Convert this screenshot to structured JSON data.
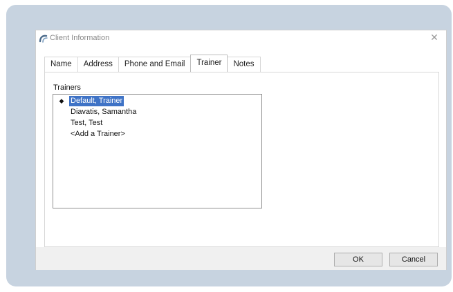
{
  "window": {
    "title": "Client Information",
    "close_glyph": "✕"
  },
  "tabs": [
    {
      "label": "Name"
    },
    {
      "label": "Address"
    },
    {
      "label": "Phone and Email"
    },
    {
      "label": "Trainer",
      "active": true
    },
    {
      "label": "Notes"
    }
  ],
  "trainer_tab": {
    "group_label": "Trainers",
    "items": [
      {
        "label": "Default, Trainer",
        "selected": true,
        "marker": "◆"
      },
      {
        "label": "Diavatis, Samantha"
      },
      {
        "label": "Test, Test"
      },
      {
        "label": "<Add a Trainer>"
      }
    ]
  },
  "buttons": {
    "ok": "OK",
    "cancel": "Cancel"
  },
  "colors": {
    "background_panel": "#c7d3e0",
    "selection": "#3f73c6"
  },
  "icons": {
    "app": "app-logo-icon",
    "close": "close-icon",
    "marker": "current-item-marker-icon"
  }
}
